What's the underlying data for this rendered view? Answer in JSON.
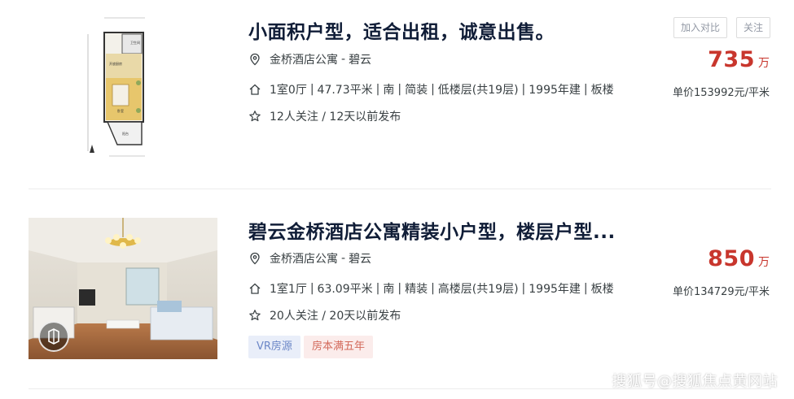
{
  "listings": [
    {
      "title": "小面积户型，适合出租，诚意出售。",
      "community": "金桥酒店公寓",
      "district": "碧云",
      "address_sep": "-",
      "info": [
        "1室0厅",
        "47.73平米",
        "南",
        "简装",
        "低楼层(共19层)",
        "1995年建",
        "板楼"
      ],
      "follow": "12人关注 / 12天以前发布",
      "price": "735",
      "price_unit": "万",
      "unit_price": "单价153992元/平米",
      "buttons": {
        "compare": "加入对比",
        "follow": "关注"
      },
      "image": "floorplan",
      "floorplan_labels": {
        "bath": "卫生间",
        "kitchen": "开放厨房",
        "bedroom": "卧室",
        "balcony": "阳台"
      }
    },
    {
      "title": "碧云金桥酒店公寓精装小户型，楼层户型...",
      "community": "金桥酒店公寓",
      "district": "碧云",
      "address_sep": "-",
      "info": [
        "1室1厅",
        "63.09平米",
        "南",
        "精装",
        "高楼层(共19层)",
        "1995年建",
        "板楼"
      ],
      "follow": "20人关注 / 20天以前发布",
      "price": "850",
      "price_unit": "万",
      "unit_price": "单价134729元/平米",
      "tags": [
        "VR房源",
        "房本满五年"
      ],
      "image": "room-photo"
    }
  ],
  "watermark": "搜狐号@搜狐焦点黄冈站",
  "icons": {
    "location": "location-pin-icon",
    "house": "house-icon",
    "star": "star-icon",
    "vr": "vr-badge-icon"
  },
  "colors": {
    "price": "#c8362d",
    "title": "#101d37",
    "text": "#394043",
    "tag_vr_bg": "#e9eef9",
    "tag_vr_fg": "#6c87c7",
    "tag_five_bg": "#fbeceb",
    "tag_five_fg": "#d36a5b"
  }
}
